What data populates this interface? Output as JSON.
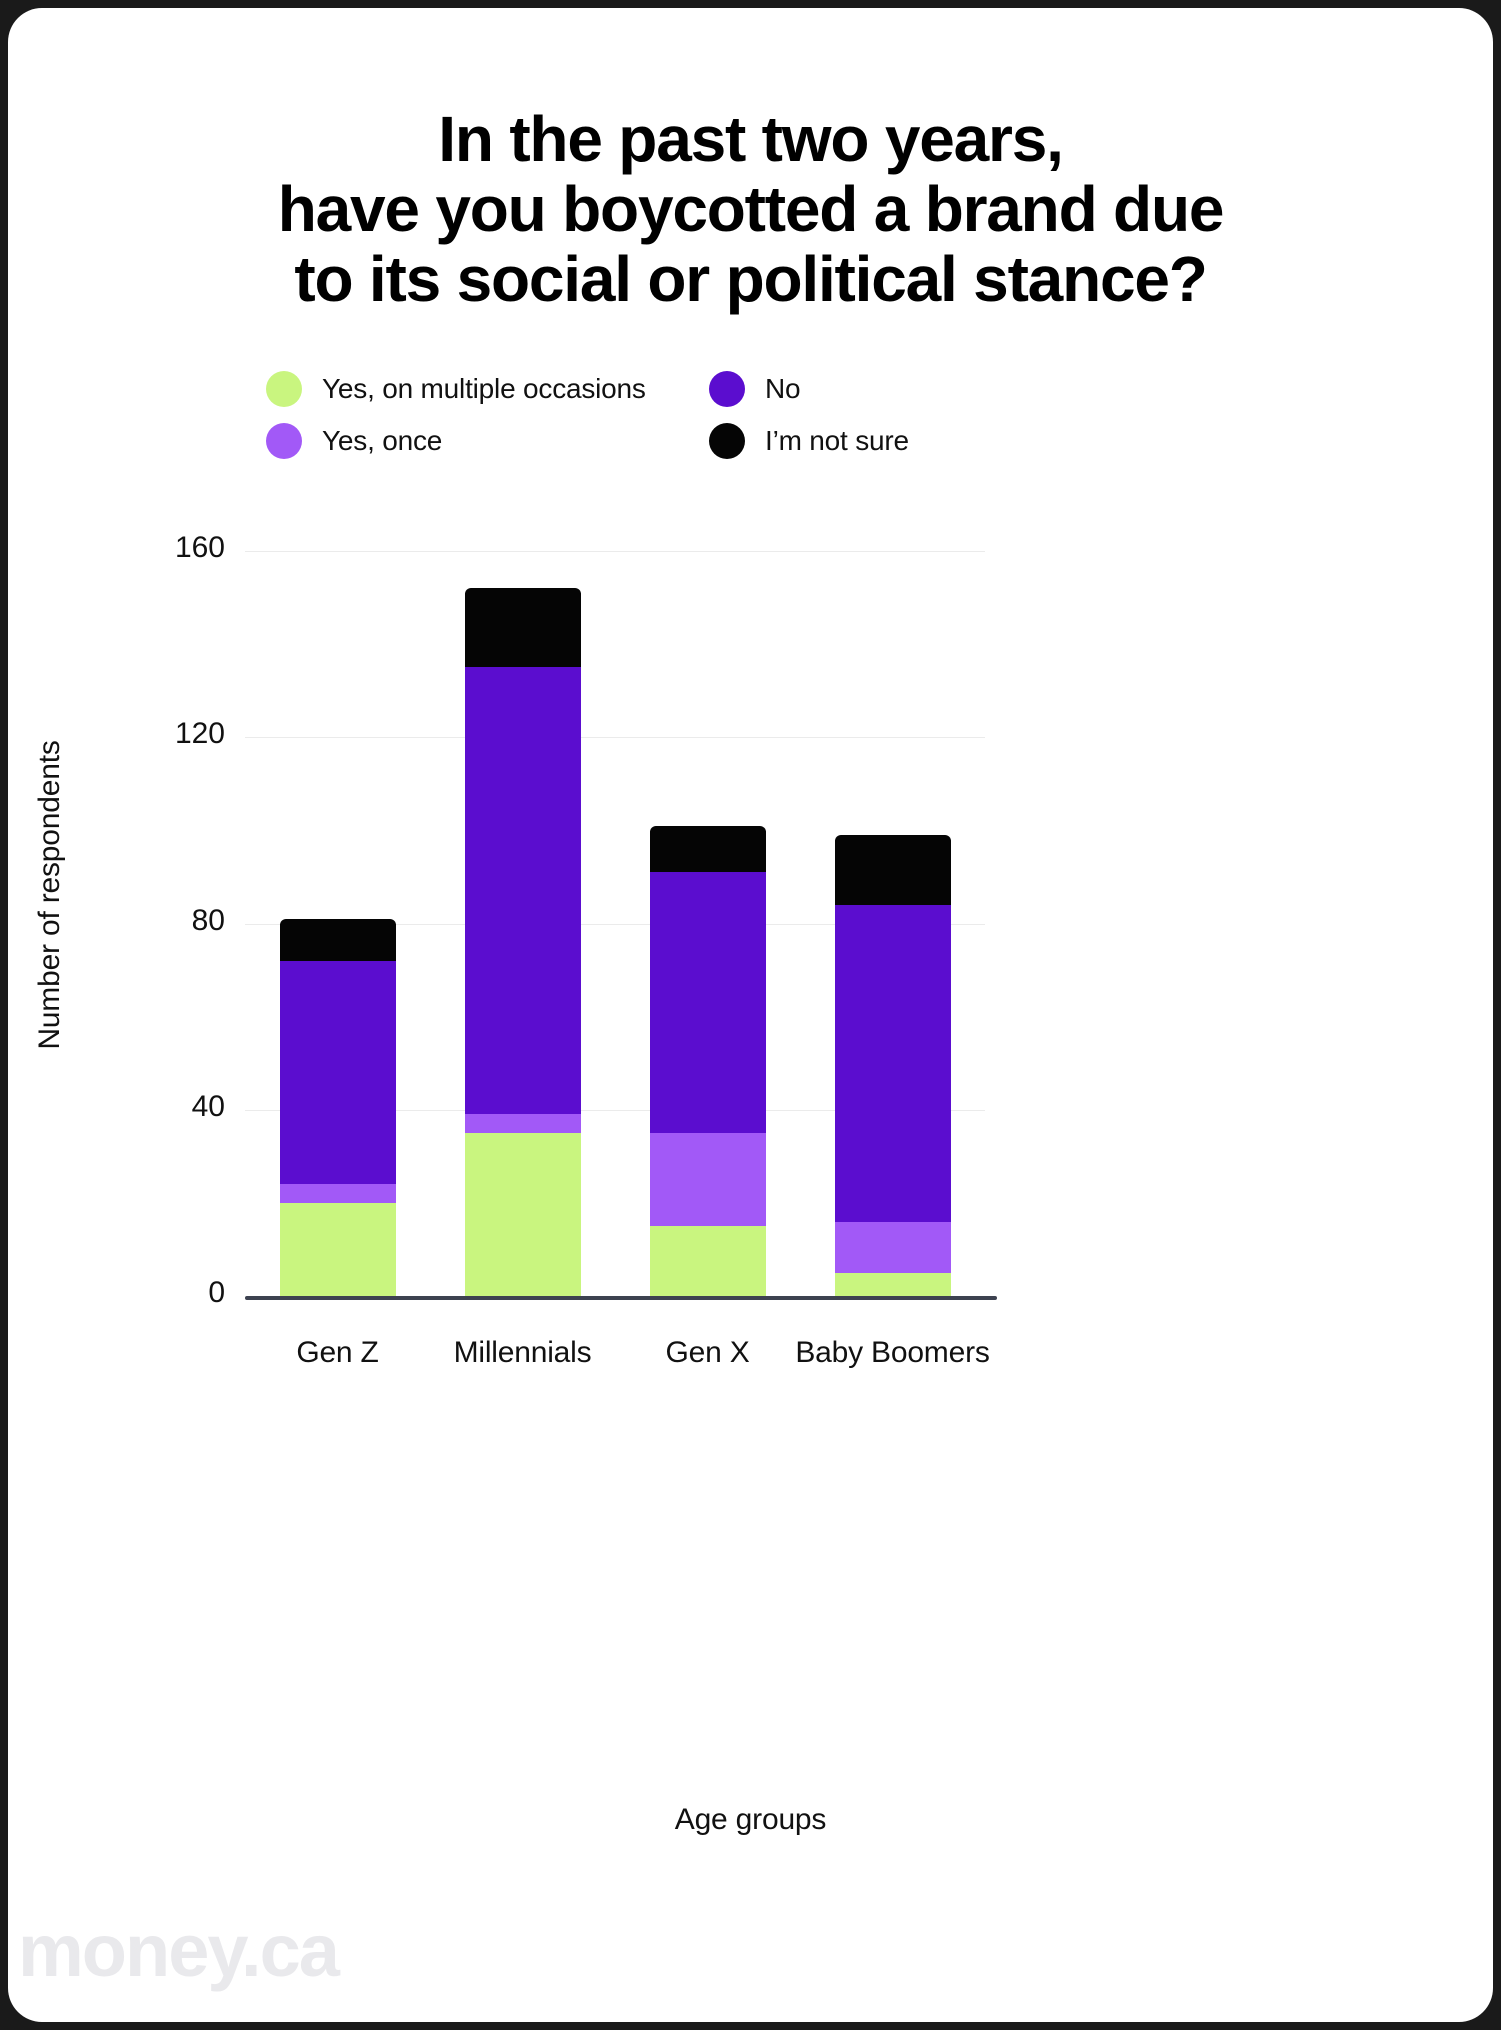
{
  "title": "In the past two years,\nhave you boycotted a brand due\nto its social or political stance?",
  "watermark": "money.ca",
  "legend": {
    "items": [
      {
        "label": "Yes, on multiple occasions",
        "color": "#c9f57f",
        "icon": "circle-swatch-icon"
      },
      {
        "label": "Yes, once",
        "color": "#a259f7",
        "icon": "circle-swatch-icon"
      },
      {
        "label": "No",
        "color": "#5b0dcf",
        "icon": "circle-swatch-icon"
      },
      {
        "label": "I’m not sure",
        "color": "#050505",
        "icon": "circle-swatch-icon"
      }
    ]
  },
  "chart_data": {
    "type": "bar",
    "stacked": true,
    "title": "In the past two years, have you boycotted a brand due to its social or political stance?",
    "xlabel": "Age groups",
    "ylabel": "Number of respondents",
    "categories": [
      "Gen Z",
      "Millennials",
      "Gen X",
      "Baby Boomers"
    ],
    "yticks": [
      0,
      40,
      80,
      120,
      160
    ],
    "ylim": [
      0,
      160
    ],
    "grid": true,
    "legend_position": "top",
    "series": [
      {
        "name": "Yes, on multiple occasions",
        "color": "#c9f57f",
        "values": [
          20,
          35,
          15,
          5
        ]
      },
      {
        "name": "Yes, once",
        "color": "#a259f7",
        "values": [
          4,
          4,
          20,
          11
        ]
      },
      {
        "name": "No",
        "color": "#5b0dcf",
        "values": [
          48,
          96,
          56,
          68
        ]
      },
      {
        "name": "I’m not sure",
        "color": "#050505",
        "values": [
          9,
          17,
          10,
          15
        ]
      }
    ],
    "totals": [
      81,
      152,
      101,
      99
    ]
  }
}
